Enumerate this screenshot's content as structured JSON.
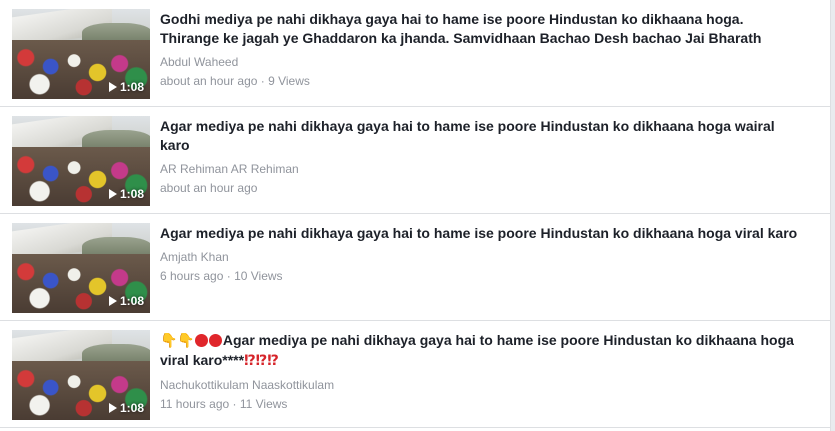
{
  "videos": [
    {
      "title": "Godhi mediya pe nahi dikhaya gaya hai to hame ise poore Hindustan ko dikhaana hoga. Thirange ke jagah ye Ghaddaron ka jhanda. Samvidhaan Bachao Desh bachao Jai Bharath",
      "author": "Abdul Waheed",
      "time": "about an hour ago",
      "views": "9 Views",
      "duration": "1:08"
    },
    {
      "title": "Agar mediya pe nahi dikhaya gaya hai to hame ise poore Hindustan ko dikhaana hoga wairal karo",
      "author": "AR Rehiman AR Rehiman",
      "time": "about an hour ago",
      "views": "",
      "duration": "1:08"
    },
    {
      "title": "Agar mediya pe nahi dikhaya gaya hai to hame ise poore Hindustan ko dikhaana hoga viral karo",
      "author": "Amjath Khan",
      "time": "6 hours ago",
      "views": "10 Views",
      "duration": "1:08"
    },
    {
      "title_prefix_emoji": "👇👇",
      "title": "Agar mediya pe nahi dikhaya gaya hai to hame ise poore Hindustan ko dikhaana hoga viral karo****",
      "title_suffix_emoji": "⁉⁉⁉",
      "author": "Nachukottikulam Naaskottikulam",
      "time": "11 hours ago",
      "views": "11 Views",
      "duration": "1:08"
    }
  ],
  "separator": " · ",
  "icons": {
    "play": "play-icon",
    "pointing_down": "pointing-down-icon",
    "red_circle": "red-circle-icon",
    "interrobang": "interrobang-icon"
  },
  "colors": {
    "title": "#1d2129",
    "meta": "#90949c",
    "divider": "#dddfe2",
    "background": "#e9ebee",
    "emoji_red": "#e0262b"
  }
}
